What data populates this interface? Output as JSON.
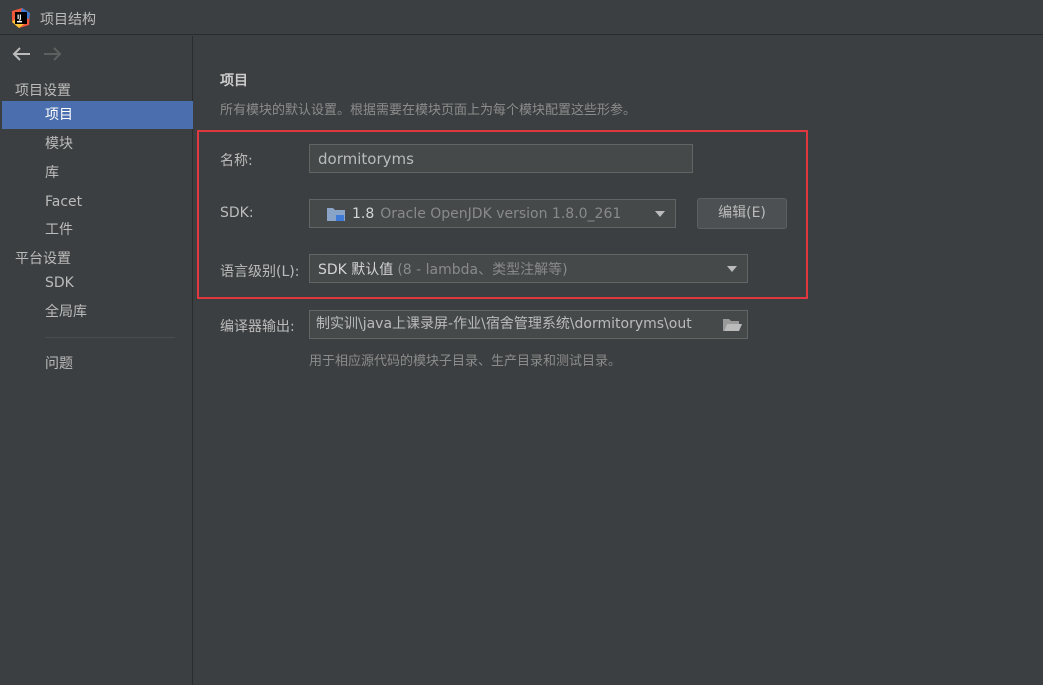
{
  "window": {
    "title": "项目结构"
  },
  "sidebar": {
    "headers": {
      "project_settings": "项目设置",
      "platform_settings": "平台设置"
    },
    "items": [
      {
        "label": "项目",
        "selected": true
      },
      {
        "label": "模块"
      },
      {
        "label": "库"
      },
      {
        "label": "Facet"
      },
      {
        "label": "工件"
      },
      {
        "label": "SDK"
      },
      {
        "label": "全局库"
      },
      {
        "label": "问题"
      }
    ]
  },
  "main": {
    "title": "项目",
    "description": "所有模块的默认设置。根据需要在模块页面上为每个模块配置这些形参。",
    "name_label": "名称:",
    "name_value": "dormitoryms",
    "sdk_label": "SDK:",
    "sdk_version": "1.8",
    "sdk_detail": "Oracle OpenJDK version 1.8.0_261",
    "edit_button": "编辑(E)",
    "language_label": "语言级别(L):",
    "language_value": "SDK 默认值",
    "language_detail": "(8 - lambda、类型注解等)",
    "output_label": "编译器输出:",
    "output_path": "制实训\\java上课录屏-作业\\宿舍管理系统\\dormitoryms\\out",
    "output_hint": "用于相应源代码的模块子目录、生产目录和测试目录。"
  },
  "colors": {
    "background": "#3c3f41",
    "selection": "#4b6eaf",
    "highlight_box": "#e0383e"
  }
}
